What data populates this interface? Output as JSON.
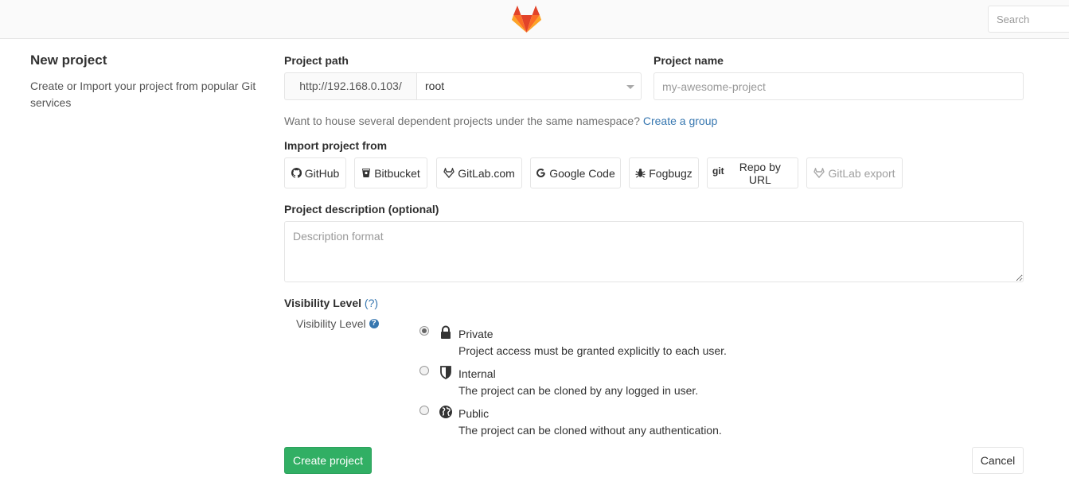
{
  "header": {
    "search_placeholder": "Search"
  },
  "sidebar": {
    "title": "New project",
    "description": "Create or Import your project from popular Git services"
  },
  "form": {
    "project_path_label": "Project path",
    "path_prefix": "http://192.168.0.103/",
    "namespace": "root",
    "project_name_label": "Project name",
    "project_name_placeholder": "my-awesome-project",
    "group_hint": "Want to house several dependent projects under the same namespace?",
    "create_group_link": "Create a group",
    "import_label": "Import project from",
    "import_sources": [
      {
        "label": "GitHub",
        "icon": "github-icon"
      },
      {
        "label": "Bitbucket",
        "icon": "bitbucket-icon"
      },
      {
        "label": "GitLab.com",
        "icon": "gitlab-icon"
      },
      {
        "label": "Google Code",
        "icon": "google-icon"
      },
      {
        "label": "Fogbugz",
        "icon": "bug-icon"
      },
      {
        "label": "Repo by URL",
        "icon": "git-icon",
        "icon_text": "git"
      },
      {
        "label": "GitLab export",
        "icon": "gitlab-icon"
      }
    ],
    "description_label": "Project description (optional)",
    "description_placeholder": "Description format",
    "visibility_label": "Visibility Level",
    "visibility_help": "(?)",
    "visibility_sub_label": "Visibility Level",
    "visibility_options": [
      {
        "title": "Private",
        "desc": "Project access must be granted explicitly to each user.",
        "icon": "lock-icon",
        "selected": true
      },
      {
        "title": "Internal",
        "desc": "The project can be cloned by any logged in user.",
        "icon": "shield-icon",
        "selected": false
      },
      {
        "title": "Public",
        "desc": "The project can be cloned without any authentication.",
        "icon": "globe-icon",
        "selected": false
      }
    ],
    "create_label": "Create project",
    "cancel_label": "Cancel"
  },
  "colors": {
    "accent_green": "#31af64",
    "link_blue": "#3777b0",
    "logo_orange": "#fc6d26",
    "logo_red": "#e24329"
  }
}
